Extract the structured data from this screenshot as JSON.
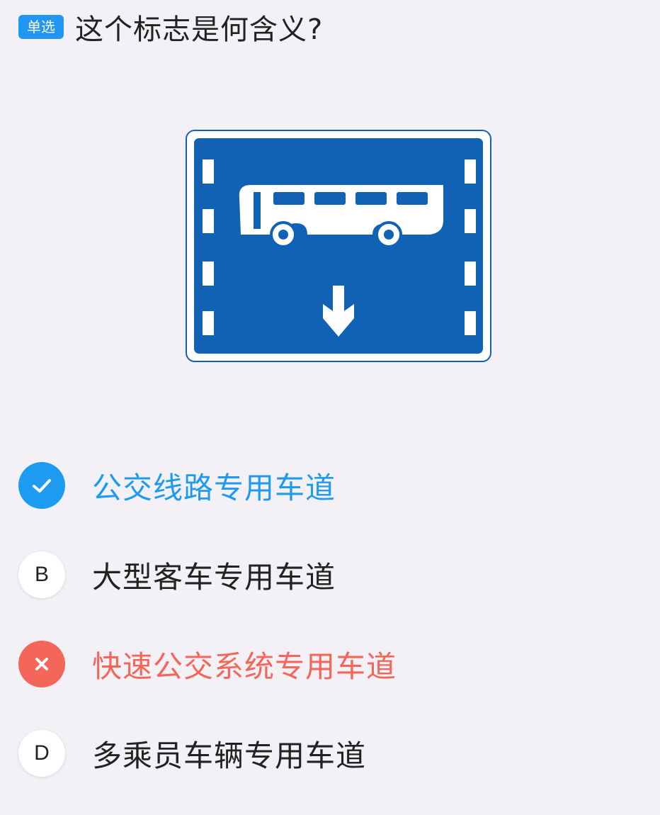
{
  "question": {
    "type_badge": "单选",
    "text": "这个标志是何含义?"
  },
  "colors": {
    "accent": "#1c9bf0",
    "wrong": "#f4655a",
    "sign_blue": "#1162b5",
    "background": "#f3f1f5"
  },
  "sign": {
    "icon": "bus-lane-sign-icon"
  },
  "options": [
    {
      "marker": "",
      "marker_icon": "check-icon",
      "label": "公交线路专用车道",
      "state": "correct"
    },
    {
      "marker": "B",
      "marker_icon": "",
      "label": "大型客车专用车道",
      "state": "unselected"
    },
    {
      "marker": "",
      "marker_icon": "close-icon",
      "label": "快速公交系统专用车道",
      "state": "wrong"
    },
    {
      "marker": "D",
      "marker_icon": "",
      "label": "多乘员车辆专用车道",
      "state": "unselected"
    }
  ]
}
